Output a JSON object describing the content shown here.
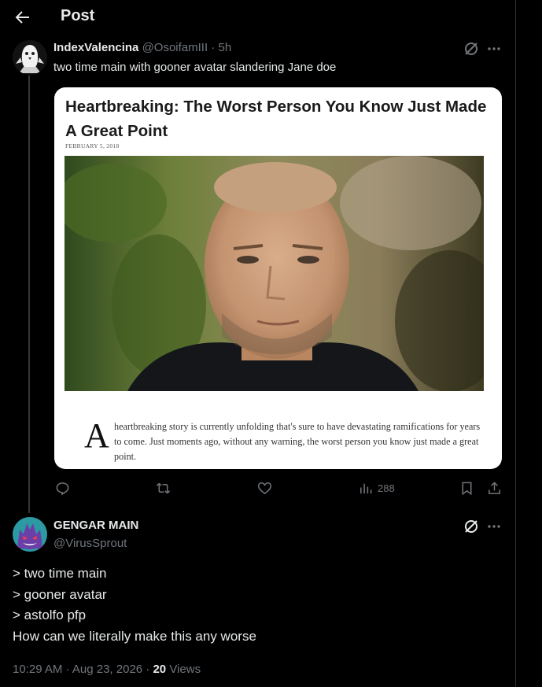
{
  "header": {
    "title": "Post",
    "back_icon": "arrow-left-icon"
  },
  "colors": {
    "background": "#000000",
    "text": "#e7e9ea",
    "muted": "#71767b",
    "divider": "#2f3336"
  },
  "parent_tweet": {
    "display_name": "IndexValencina",
    "handle": "@OsoifamIII",
    "time": "· 5h",
    "text": "two time main with gooner avatar slandering Jane doe",
    "card": {
      "headline": "Heartbreaking: The Worst Person You Know Just Made A Great Point",
      "date": "FEBRUARY 5, 2018",
      "dropcap": "A",
      "body": "heartbreaking story is currently unfolding that's sure to have devastating ramifications for years to come. Just moments ago, without any warning, the worst person you know just made a great point."
    },
    "actions": {
      "reply_icon": "reply-icon",
      "retweet_icon": "retweet-icon",
      "like_icon": "heart-icon",
      "views_icon": "views-icon",
      "views": "288",
      "bookmark_icon": "bookmark-icon",
      "share_icon": "share-icon"
    }
  },
  "reply_tweet": {
    "display_name": "GENGAR MAIN",
    "handle": "@VirusSprout",
    "lines": [
      "> two time main",
      "> gooner avatar",
      "> astolfo pfp",
      "How can we literally make this any worse"
    ],
    "timestamp": "10:29 AM · Aug 23, 2026",
    "separator": " · ",
    "views_count": "20",
    "views_label": " Views"
  }
}
